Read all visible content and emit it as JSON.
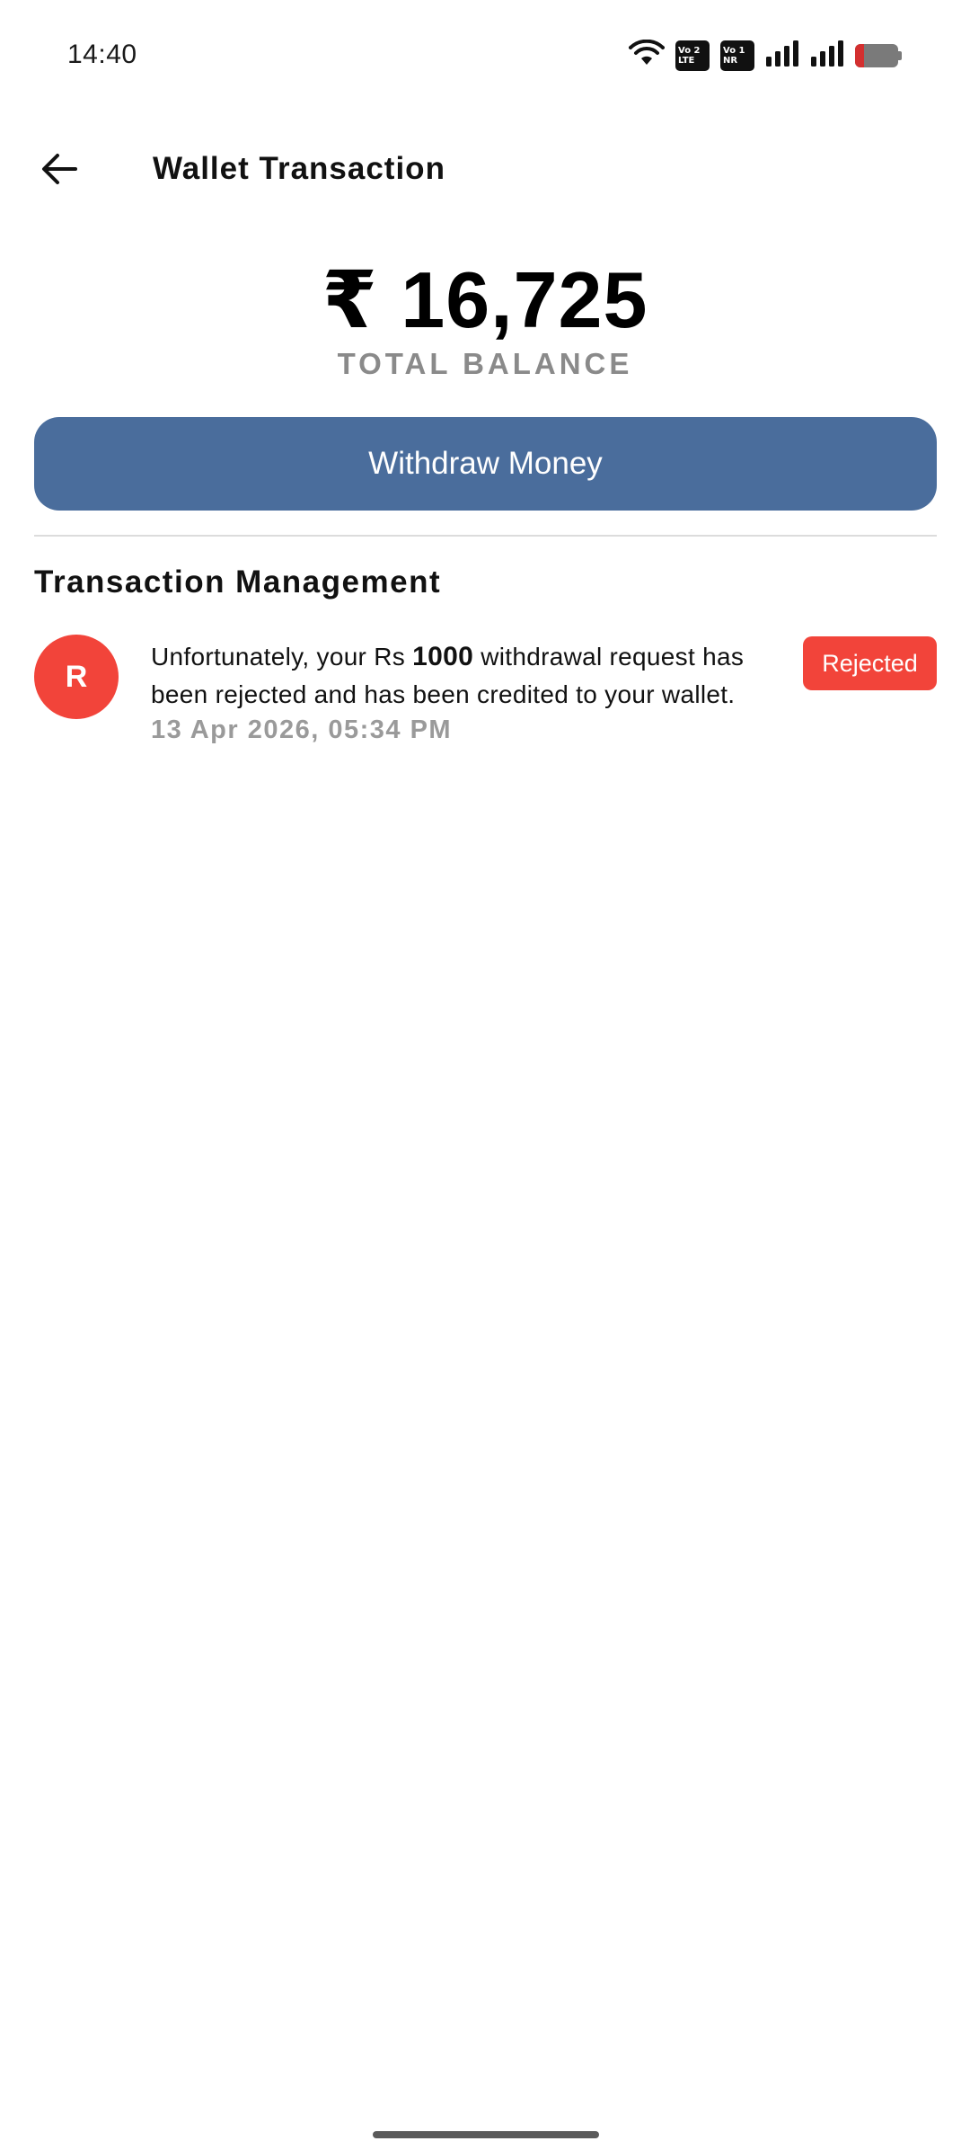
{
  "status_bar": {
    "time": "14:40",
    "icons": [
      "wifi-icon",
      "volte-sim-1-icon",
      "vonr-sim-2-icon",
      "signal-icon",
      "signal-icon",
      "battery-icon"
    ],
    "sim1": {
      "row1": "Vo 2",
      "row2": "LTE"
    },
    "sim2": {
      "row1": "Vo 1",
      "row2": "NR"
    },
    "battery_level": 0.2,
    "battery_color": "#d32f2f"
  },
  "header": {
    "back_icon": "arrow-left-icon",
    "title": "Wallet Transaction"
  },
  "balance": {
    "amount": "₹ 16,725",
    "label": "TOTAL BALANCE"
  },
  "withdraw_button": {
    "label": "Withdraw Money",
    "color": "#4a6d9c"
  },
  "section": {
    "title": "Transaction Management"
  },
  "transactions": [
    {
      "avatar_letter": "R",
      "message_prefix": "Unfortunately, your Rs ",
      "amount": "1000",
      "message_suffix": " withdrawal request has been rejected and has been credited to your wallet.",
      "date": "13 Apr 2026, 05:34 PM",
      "status": "Rejected",
      "status_color": "#f2443a"
    }
  ]
}
